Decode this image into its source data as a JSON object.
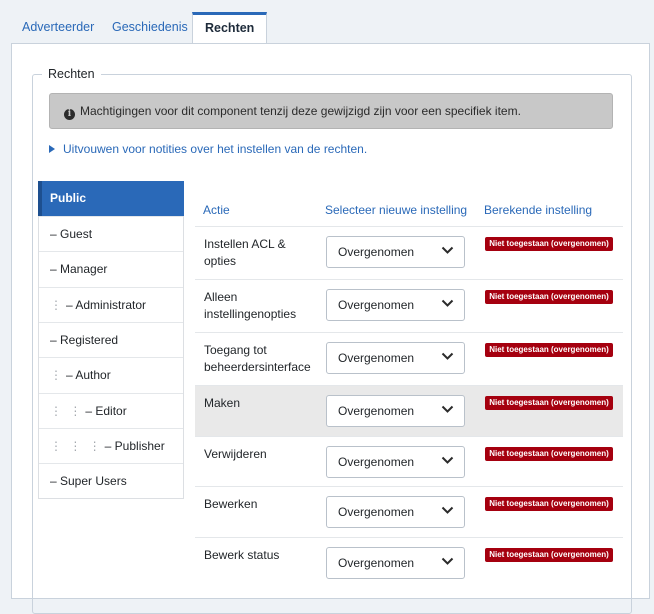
{
  "tabs": [
    {
      "label": "Adverteerder"
    },
    {
      "label": "Geschiedenis"
    },
    {
      "label": "Rechten"
    }
  ],
  "fieldset": {
    "legend": "Rechten"
  },
  "alert": {
    "text": "Machtigingen voor dit component tenzij deze gewijzigd zijn voor een specifiek item."
  },
  "toggle": {
    "label": "Uitvouwen voor notities over het instellen van de rechten."
  },
  "groups": [
    {
      "label": "Public"
    },
    {
      "label": "– Guest"
    },
    {
      "label": "– Manager"
    },
    {
      "dots": "⋮",
      "label": "– Administrator"
    },
    {
      "label": "– Registered"
    },
    {
      "dots": "⋮",
      "label": "– Author"
    },
    {
      "dots": "⋮ ⋮",
      "label": "– Editor"
    },
    {
      "dots": "⋮ ⋮ ⋮",
      "label": "– Publisher"
    },
    {
      "label": "– Super Users"
    }
  ],
  "table": {
    "headers": {
      "action": "Actie",
      "select": "Selecteer nieuwe instelling",
      "computed": "Berekende instelling"
    },
    "rows": [
      {
        "action": "Instellen ACL & opties",
        "setting": "Overgenomen",
        "computed": "Niet toegestaan (overgenomen)"
      },
      {
        "action": "Alleen instellingenopties",
        "setting": "Overgenomen",
        "computed": "Niet toegestaan (overgenomen)"
      },
      {
        "action": "Toegang tot beheerdersinterface",
        "setting": "Overgenomen",
        "computed": "Niet toegestaan (overgenomen)"
      },
      {
        "action": "Maken",
        "setting": "Overgenomen",
        "computed": "Niet toegestaan (overgenomen)"
      },
      {
        "action": "Verwijderen",
        "setting": "Overgenomen",
        "computed": "Niet toegestaan (overgenomen)"
      },
      {
        "action": "Bewerken",
        "setting": "Overgenomen",
        "computed": "Niet toegestaan (overgenomen)"
      },
      {
        "action": "Bewerk status",
        "setting": "Overgenomen",
        "computed": "Niet toegestaan (overgenomen)"
      }
    ]
  },
  "colors": {
    "accent": "#2a69b8",
    "danger": "#a5000f",
    "alert_bg": "#c8c8c8"
  },
  "icons": {
    "alert": "info-icon",
    "toggle": "triangle-right-icon",
    "select": "chevron-down-icon"
  }
}
